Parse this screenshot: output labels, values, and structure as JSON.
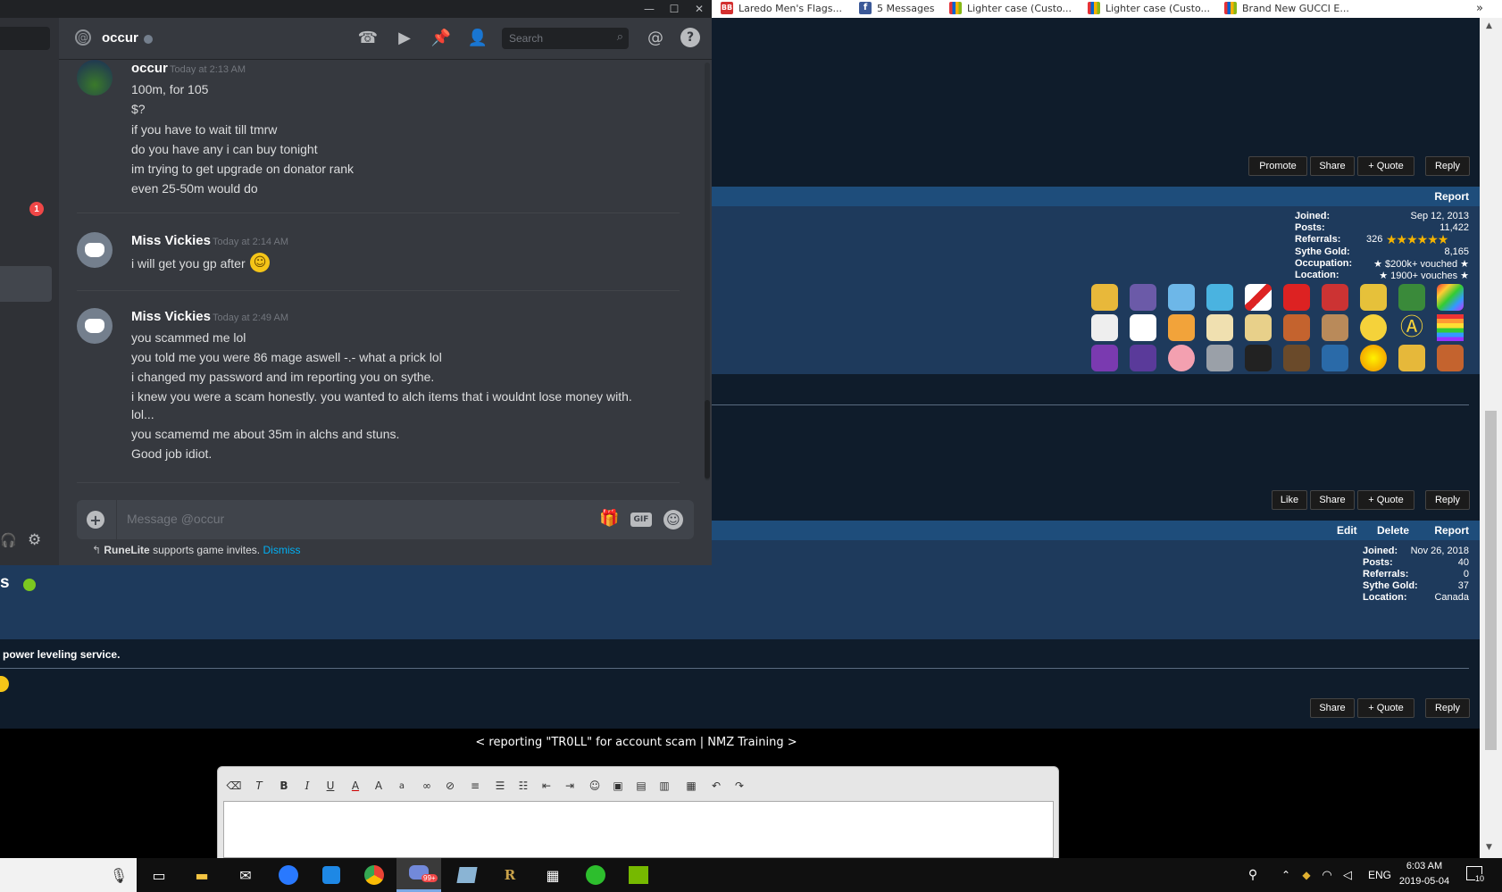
{
  "browser": {
    "bookmarks": [
      {
        "label": "Laredo Men's Flags...",
        "icon": "bb-icon",
        "color": "#d32f2f"
      },
      {
        "label": "5 Messages",
        "icon": "facebook-icon",
        "color": "#3b5998"
      },
      {
        "label": "Lighter case (Custo...",
        "icon": "ebay-icon",
        "color": "#e53238"
      },
      {
        "label": "Lighter case (Custo...",
        "icon": "ebay-icon",
        "color": "#e53238"
      },
      {
        "label": "Brand New GUCCI E...",
        "icon": "ebay-icon",
        "color": "#e53238"
      }
    ],
    "overflow": "»"
  },
  "forum": {
    "post1_buttons": [
      "Promote",
      "Share",
      "+ Quote",
      "Reply"
    ],
    "post2_bar_link": "Report",
    "post2_stats": [
      {
        "k": "Joined:",
        "v": "Sep 12, 2013"
      },
      {
        "k": "Posts:",
        "v": "11,422"
      },
      {
        "k": "Referrals:",
        "v": "326"
      },
      {
        "k": "Sythe Gold:",
        "v": "8,165"
      },
      {
        "k": "Occupation:",
        "v": "★ $200k+ vouched ★"
      },
      {
        "k": "Location:",
        "v": "★ 1900+ vouches ★"
      }
    ],
    "post2_buttons": [
      "Like",
      "Share",
      "+ Quote",
      "Reply"
    ],
    "post3_bar_links": [
      "Edit",
      "Delete",
      "Report"
    ],
    "post3_stats": [
      {
        "k": "Joined:",
        "v": "Nov 26, 2018"
      },
      {
        "k": "Posts:",
        "v": "40"
      },
      {
        "k": "Referrals:",
        "v": "0"
      },
      {
        "k": "Sythe Gold:",
        "v": "37"
      },
      {
        "k": "Location:",
        "v": "Canada"
      }
    ],
    "post3_user_fragment": "s",
    "post4_text": "power leveling service.",
    "post4_buttons": [
      "Share",
      "+ Quote",
      "Reply"
    ],
    "thread_nav": "< reporting \"TR0LL\" for account scam | NMZ Training >"
  },
  "discord": {
    "dm_name": "occur",
    "search_placeholder": "Search",
    "unread_badge": "1",
    "messages": [
      {
        "author": "occur",
        "time": "Today at 2:13 AM",
        "avatar": "occur-avatar",
        "lines": [
          "100m, for 105",
          "$?",
          "if you have to wait till tmrw",
          "do you have any i can buy tonight",
          "im trying to get upgrade on donator rank",
          "even 25-50m would do"
        ]
      },
      {
        "author": "Miss Vickies",
        "time": "Today at 2:14 AM",
        "avatar": "discord-avatar",
        "lines": [
          "i will get you gp after"
        ]
      },
      {
        "author": "Miss Vickies",
        "time": "Today at 2:49 AM",
        "avatar": "discord-avatar",
        "lines": [
          "you scammed me lol",
          "you told me you were 86 mage aswell -.- what a prick lol",
          "i changed my password and im reporting you on sythe.",
          "i knew you were a scam honestly. you wanted to alch items that i wouldnt lose money with.",
          "lol...",
          "you scamemd me about 35m in alchs and stuns.",
          "Good job idiot."
        ]
      }
    ],
    "input_placeholder": "Message @occur",
    "game_invite": {
      "app": "RuneLite",
      "text": " supports game invites.",
      "dismiss": "Dismiss"
    }
  },
  "taskbar": {
    "language": "ENG",
    "time": "6:03 AM",
    "date": "2019-05-04",
    "notifications": "10",
    "discord_badge": "99+"
  }
}
